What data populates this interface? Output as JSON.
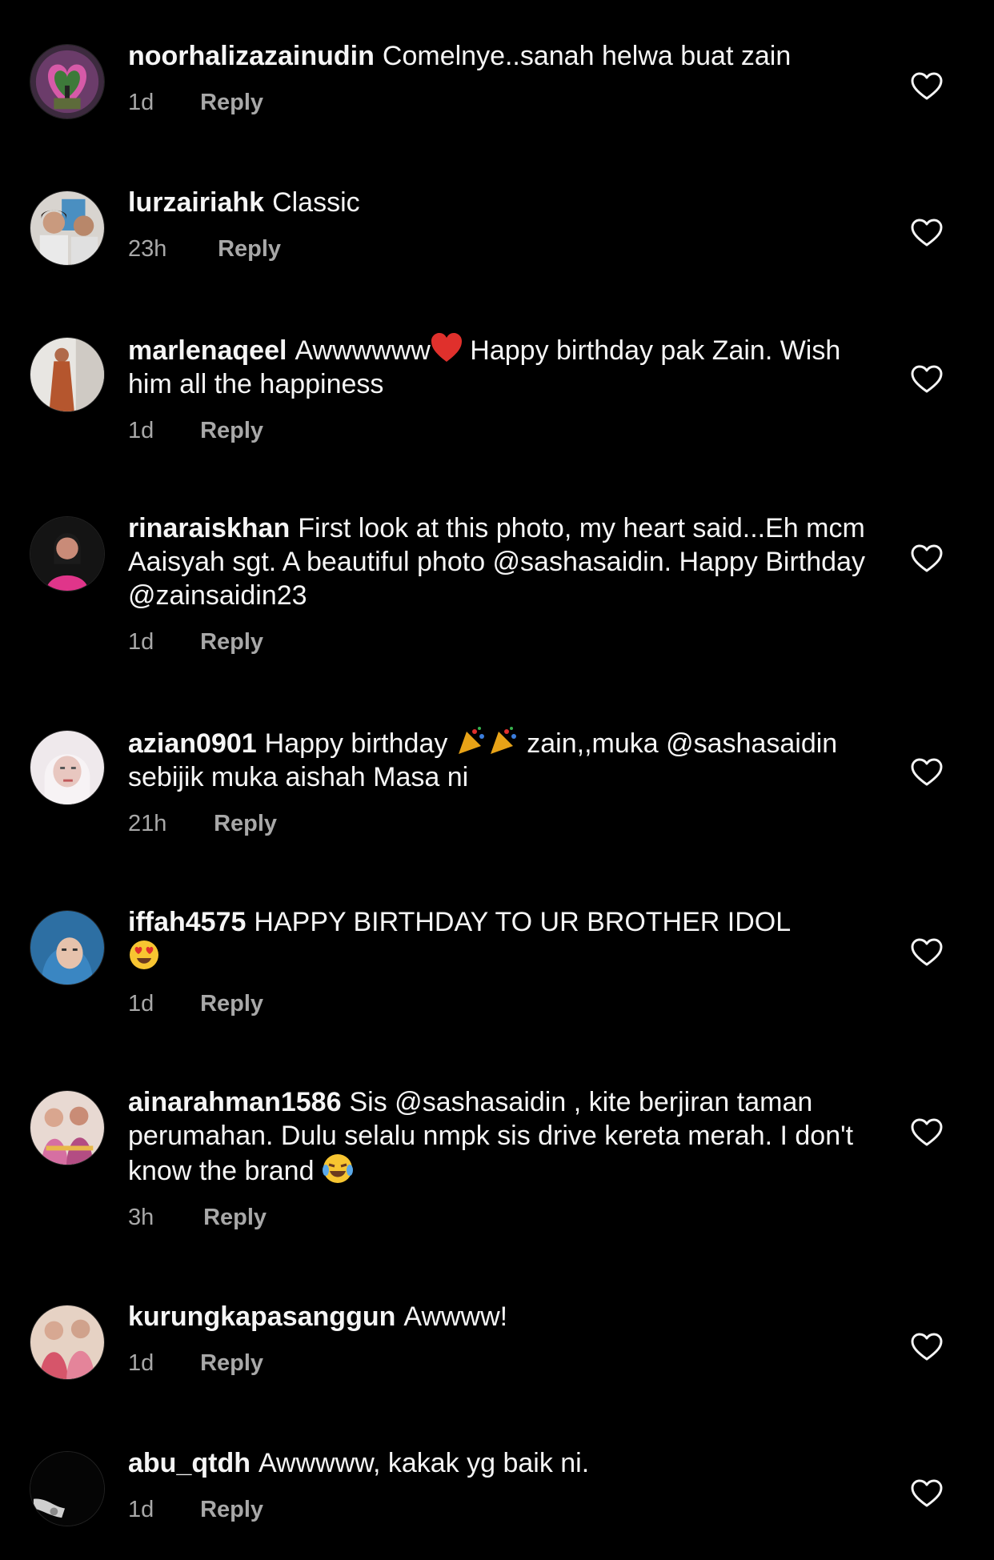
{
  "reply_label": "Reply",
  "comments": [
    {
      "username": "noorhalizazainudin",
      "text": "Comelnye..sanah helwa buat zain",
      "time": "1d",
      "avatar_icon": "heart-arch-photo"
    },
    {
      "username": "lurzairiahk",
      "text": "Classic",
      "time": "23h",
      "avatar_icon": "two-people-photo"
    },
    {
      "username": "marlenaqeel",
      "text_before": "Awwwwww",
      "emoji": "red-heart",
      "text_after": " Happy birthday pak Zain. Wish him all the happiness",
      "time": "1d",
      "avatar_icon": "woman-orange-dress-photo"
    },
    {
      "username": "rinaraiskhan",
      "text": "First look at this photo, my heart said...Eh mcm Aaisyah sgt. A beautiful photo @sashasaidin. Happy Birthday @zainsaidin23",
      "time": "1d",
      "avatar_icon": "woman-pink-photo"
    },
    {
      "username": "azian0901",
      "text_before": "Happy birthday ",
      "emoji": "party-popper",
      "text_after": " zain,,muka @sashasaidin  sebijik muka aishah Masa ni",
      "time": "21h",
      "avatar_icon": "woman-hijab-white-photo"
    },
    {
      "username": "iffah4575",
      "text_before": "HAPPY BIRTHDAY TO UR BROTHER IDOL ",
      "emoji": "heart-eyes-face",
      "text_after": "",
      "time": "1d",
      "avatar_icon": "woman-blue-hijab-photo"
    },
    {
      "username": "ainarahman1586",
      "text_before": "Sis @sashasaidin , kite berjiran taman perumahan. Dulu selalu nmpk sis drive kereta merah. I don't know the brand ",
      "emoji": "tears-of-joy-face",
      "text_after": "",
      "time": "3h",
      "avatar_icon": "wedding-couple-photo"
    },
    {
      "username": "kurungkapasanggun",
      "text": "Awwww!",
      "time": "1d",
      "avatar_icon": "two-women-pink-photo"
    },
    {
      "username": "abu_qtdh",
      "text": "Awwwww, kakak yg baik ni.",
      "time": "1d",
      "avatar_icon": "dark-photo"
    }
  ],
  "colors": {
    "background": "#000000",
    "text": "#f5f5f5",
    "muted": "#a8a8a8"
  }
}
